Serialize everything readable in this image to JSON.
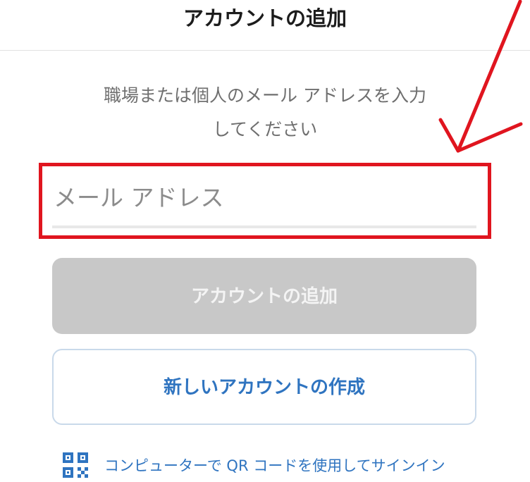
{
  "header": {
    "title": "アカウントの追加"
  },
  "main": {
    "instruction_line1": "職場または個人のメール アドレスを入力",
    "instruction_line2": "してください",
    "email_placeholder": "メール アドレス",
    "add_account_button": "アカウントの追加",
    "create_account_button": "新しいアカウントの作成",
    "qr_signin_link": "コンピューターで QR コードを使用してサインイン"
  },
  "annotation": {
    "highlight_color": "#e0151f"
  },
  "colors": {
    "accent": "#2f74c0",
    "disabled_button": "#c8c8c8"
  },
  "icons": {
    "qr": "qr-code-icon"
  }
}
